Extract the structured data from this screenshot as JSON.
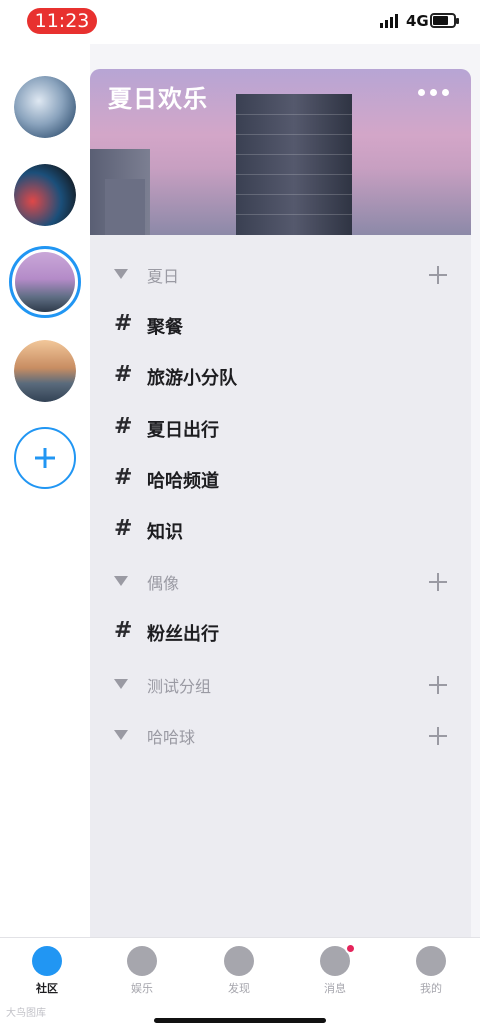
{
  "status": {
    "time": "11:23",
    "network": "4G"
  },
  "rail": {
    "avatars": [
      "avatar-1",
      "avatar-2",
      "avatar-3",
      "avatar-4"
    ],
    "add_icon": "plus-icon"
  },
  "server": {
    "title": "夏日欢乐",
    "menu_icon": "more-dots-icon"
  },
  "channels": [
    {
      "type": "group",
      "label": "夏日"
    },
    {
      "type": "channel",
      "label": "聚餐"
    },
    {
      "type": "channel",
      "label": "旅游小分队"
    },
    {
      "type": "channel",
      "label": "夏日出行"
    },
    {
      "type": "channel",
      "label": "哈哈频道"
    },
    {
      "type": "channel",
      "label": "知识"
    },
    {
      "type": "group",
      "label": "偶像"
    },
    {
      "type": "channel",
      "label": "粉丝出行"
    },
    {
      "type": "group",
      "label": "测试分组"
    },
    {
      "type": "group",
      "label": "哈哈球"
    }
  ],
  "hash_symbol": "#",
  "tabs": [
    {
      "label": "社区",
      "icon": "community-icon",
      "active": true
    },
    {
      "label": "娱乐",
      "icon": "music-disc-icon"
    },
    {
      "label": "发现",
      "icon": "compass-icon"
    },
    {
      "label": "消息",
      "icon": "message-icon",
      "badge": true
    },
    {
      "label": "我的",
      "icon": "profile-icon"
    }
  ],
  "watermark": "大鸟图库",
  "colors": {
    "accent": "#2196f3",
    "badge": "#e5245b",
    "status_time_bg": "#e8312f"
  }
}
